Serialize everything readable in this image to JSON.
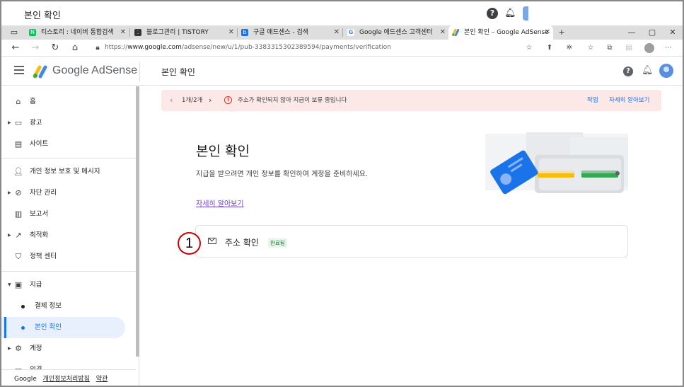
{
  "window": {
    "title": "본인 확인"
  },
  "tabs": [
    {
      "label": "티스토리 : 네이버 통합검색",
      "favicon_color": "#03c75a"
    },
    {
      "label": "블로그관리 | TISTORY",
      "favicon_color": "#333333"
    },
    {
      "label": "구글 애드센스 - 검색",
      "favicon_color": "#1a73e8"
    },
    {
      "label": "Google 애드센스 고객센터",
      "favicon_color": "#4285f4"
    },
    {
      "label": "본인 확인 – Google AdSense",
      "favicon_color": "#fbbc04",
      "active": true
    }
  ],
  "address": {
    "url_prefix": "https://",
    "url_host": "www.google.com",
    "url_path": "/adsense/new/u/1/pub-3383315302389594/payments/verification"
  },
  "header": {
    "brand": "Google AdSense",
    "page_title": "본인 확인"
  },
  "sidebar": {
    "items": [
      {
        "label": "홈",
        "icon": "home-icon"
      },
      {
        "label": "광고",
        "icon": "ads-icon",
        "expandable": true
      },
      {
        "label": "사이트",
        "icon": "sites-icon"
      },
      {
        "label": "개인 정보 보호 및 메시지",
        "icon": "privacy-icon"
      },
      {
        "label": "차단 관리",
        "icon": "block-icon",
        "expandable": true
      },
      {
        "label": "보고서",
        "icon": "reports-icon"
      },
      {
        "label": "최적화",
        "icon": "optimize-icon",
        "expandable": true
      },
      {
        "label": "정책 센터",
        "icon": "policy-icon"
      },
      {
        "label": "지급",
        "icon": "payments-icon",
        "expanded": true
      },
      {
        "label": "결제 정보",
        "sub": true
      },
      {
        "label": "본인 확인",
        "sub": true,
        "active": true
      },
      {
        "label": "계정",
        "icon": "account-icon",
        "expandable": true
      },
      {
        "label": "의견",
        "icon": "feedback-icon"
      }
    ],
    "footer": {
      "google": "Google",
      "privacy": "개인정보처리방침",
      "terms": "약관"
    }
  },
  "alert": {
    "pager": "1개/2개",
    "message": "주소가 확인되지 않아 지급이 보류 중입니다",
    "action": "작업",
    "learn_more": "자세히 알아보기"
  },
  "main": {
    "title": "본인 확인",
    "description": "지급을 받으려면 개인 정보를 확인하여 계정을 준비하세요.",
    "link": "자세히 알아보기",
    "step": {
      "title": "주소 확인",
      "status": "완료됨",
      "annotation_number": "1"
    }
  },
  "colors": {
    "accent": "#1a73e8",
    "alert_bg": "#fce8e6",
    "error": "#d93025",
    "success_bg": "#e6f4ea",
    "success_text": "#137333"
  }
}
